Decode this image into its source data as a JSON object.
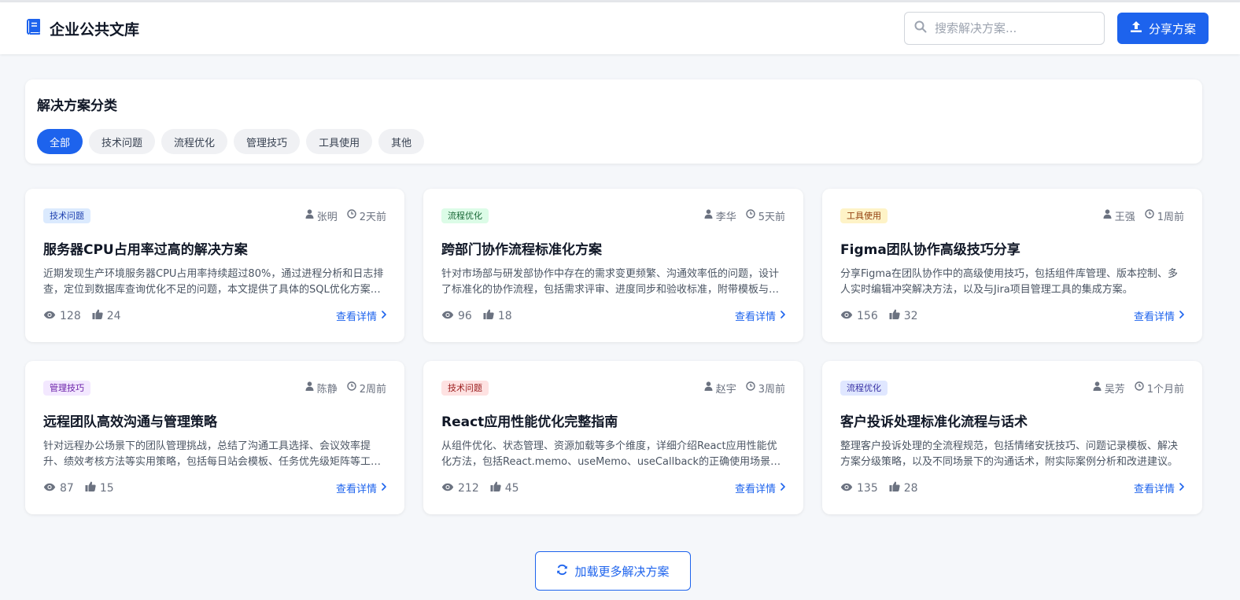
{
  "header": {
    "title": "企业公共文库",
    "logo_icon": "book-icon",
    "search_placeholder": "搜索解决方案...",
    "search_icon": "search-icon",
    "share_label": "分享方案",
    "share_icon": "upload-icon",
    "accent_color": "#1d63ed"
  },
  "categories": {
    "title": "解决方案分类",
    "items": [
      {
        "label": "全部",
        "active": true
      },
      {
        "label": "技术问题",
        "active": false
      },
      {
        "label": "流程优化",
        "active": false
      },
      {
        "label": "管理技巧",
        "active": false
      },
      {
        "label": "工具使用",
        "active": false
      },
      {
        "label": "其他",
        "active": false
      }
    ]
  },
  "tag_colors": {
    "技术问题": {
      "bg": "#dbeafe",
      "fg": "#1e40af"
    },
    "流程优化": {
      "bg": "#dcfce7",
      "fg": "#166534"
    },
    "工具使用": {
      "bg": "#fef3c7",
      "fg": "#92400e"
    },
    "管理技巧": {
      "bg": "#f3e8ff",
      "fg": "#6b21a8"
    },
    "技术问题2": {
      "bg": "#fee2e2",
      "fg": "#991b1b"
    },
    "流程优化2": {
      "bg": "#e0e7ff",
      "fg": "#3730a3"
    }
  },
  "cards": [
    {
      "tag": "技术问题",
      "tag_bg": "#dbeafe",
      "tag_fg": "#1e40af",
      "author": "张明",
      "time": "2天前",
      "title": "服务器CPU占用率过高的解决方案",
      "desc": "近期发现生产环境服务器CPU占用率持续超过80%，通过进程分析和日志排查，定位到数据库查询优化不足的问题，本文提供了具体的SQL优化方案和配置调整建议。",
      "views": "128",
      "likes": "24",
      "link": "查看详情"
    },
    {
      "tag": "流程优化",
      "tag_bg": "#dcfce7",
      "tag_fg": "#166534",
      "author": "李华",
      "time": "5天前",
      "title": "跨部门协作流程标准化方案",
      "desc": "针对市场部与研发部协作中存在的需求变更频繁、沟通效率低的问题，设计了标准化的协作流程，包括需求评审、进度同步和验收标准，附带模板与实施建议。",
      "views": "96",
      "likes": "18",
      "link": "查看详情"
    },
    {
      "tag": "工具使用",
      "tag_bg": "#fef3c7",
      "tag_fg": "#92400e",
      "author": "王强",
      "time": "1周前",
      "title": "Figma团队协作高级技巧分享",
      "desc": "分享Figma在团队协作中的高级使用技巧，包括组件库管理、版本控制、多人实时编辑冲突解决方法，以及与Jira项目管理工具的集成方案。",
      "views": "156",
      "likes": "32",
      "link": "查看详情"
    },
    {
      "tag": "管理技巧",
      "tag_bg": "#f3e8ff",
      "tag_fg": "#6b21a8",
      "author": "陈静",
      "time": "2周前",
      "title": "远程团队高效沟通与管理策略",
      "desc": "针对远程办公场景下的团队管理挑战，总结了沟通工具选择、会议效率提升、绩效考核方法等实用策略，包括每日站会模板、任务优先级矩阵等工具。",
      "views": "87",
      "likes": "15",
      "link": "查看详情"
    },
    {
      "tag": "技术问题",
      "tag_bg": "#fee2e2",
      "tag_fg": "#991b1b",
      "author": "赵宇",
      "time": "3周前",
      "title": "React应用性能优化完整指南",
      "desc": "从组件优化、状态管理、资源加载等多个维度，详细介绍React应用性能优化方法，包括React.memo、useMemo、useCallback的正确使用场景与注意事项。",
      "views": "212",
      "likes": "45",
      "link": "查看详情"
    },
    {
      "tag": "流程优化",
      "tag_bg": "#e0e7ff",
      "tag_fg": "#3730a3",
      "author": "吴芳",
      "time": "1个月前",
      "title": "客户投诉处理标准化流程与话术",
      "desc": "整理客户投诉处理的全流程规范，包括情绪安抚技巧、问题记录模板、解决方案分级策略，以及不同场景下的沟通话术，附实际案例分析和改进建议。",
      "views": "135",
      "likes": "28",
      "link": "查看详情"
    }
  ],
  "load_more": {
    "label": "加载更多解决方案",
    "icon": "refresh-icon"
  }
}
